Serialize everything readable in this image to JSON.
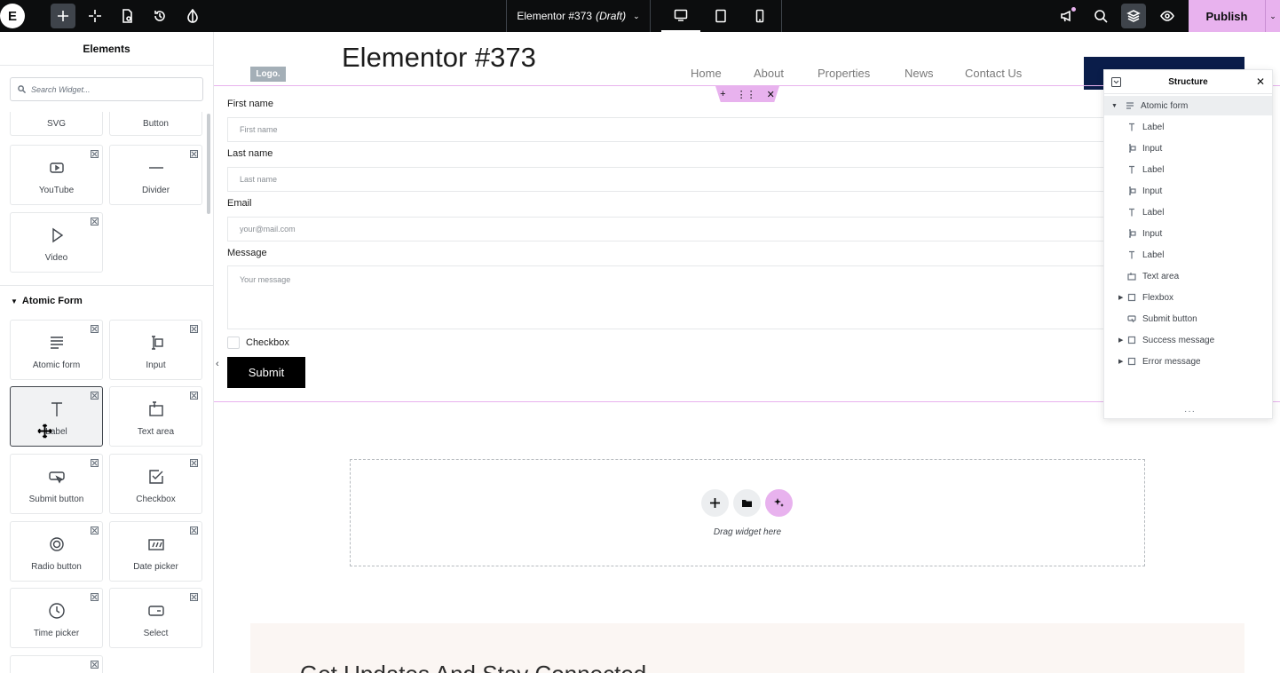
{
  "topbar": {
    "logo": "E",
    "doc_title": "Elementor #373",
    "doc_status": "(Draft)",
    "publish_label": "Publish"
  },
  "panel": {
    "title": "Elements",
    "search_placeholder": "Search Widget...",
    "top_cut_tiles": [
      "SVG",
      "Button"
    ],
    "basic_tiles": [
      "YouTube",
      "Divider",
      "Video"
    ],
    "section_title": "Atomic Form",
    "form_tiles": [
      "Atomic form",
      "Input",
      "Label",
      "Text area",
      "Submit button",
      "Checkbox",
      "Radio button",
      "Date picker",
      "Time picker",
      "Select"
    ]
  },
  "site": {
    "logo": "Logo.",
    "title": "Elementor #373",
    "nav": [
      "Home",
      "About",
      "Properties",
      "News",
      "Contact Us"
    ]
  },
  "form": {
    "fields": [
      {
        "label": "First name",
        "placeholder": "First name"
      },
      {
        "label": "Last name",
        "placeholder": "Last name"
      },
      {
        "label": "Email",
        "placeholder": "your@mail.com"
      },
      {
        "label": "Message",
        "placeholder": "Your message"
      }
    ],
    "checkbox_label": "Checkbox",
    "submit_label": "Submit"
  },
  "dropzone": {
    "text": "Drag widget here"
  },
  "bottom": {
    "heading": "Get Updates And Stay Connected"
  },
  "structure": {
    "title": "Structure",
    "items": [
      {
        "label": "Atomic form",
        "icon": "form-icon"
      },
      {
        "label": "Label",
        "icon": "text-icon"
      },
      {
        "label": "Input",
        "icon": "input-icon"
      },
      {
        "label": "Label",
        "icon": "text-icon"
      },
      {
        "label": "Input",
        "icon": "input-icon"
      },
      {
        "label": "Label",
        "icon": "text-icon"
      },
      {
        "label": "Input",
        "icon": "input-icon"
      },
      {
        "label": "Label",
        "icon": "text-icon"
      },
      {
        "label": "Text area",
        "icon": "textarea-icon"
      },
      {
        "label": "Flexbox",
        "icon": "box-icon"
      },
      {
        "label": "Submit button",
        "icon": "button-icon"
      },
      {
        "label": "Success message",
        "icon": "box-icon"
      },
      {
        "label": "Error message",
        "icon": "box-icon"
      }
    ]
  },
  "colors": {
    "accent": "#e8b2ee",
    "topbar": "#0c0d0e",
    "nav_cta": "#0a1d4a"
  }
}
